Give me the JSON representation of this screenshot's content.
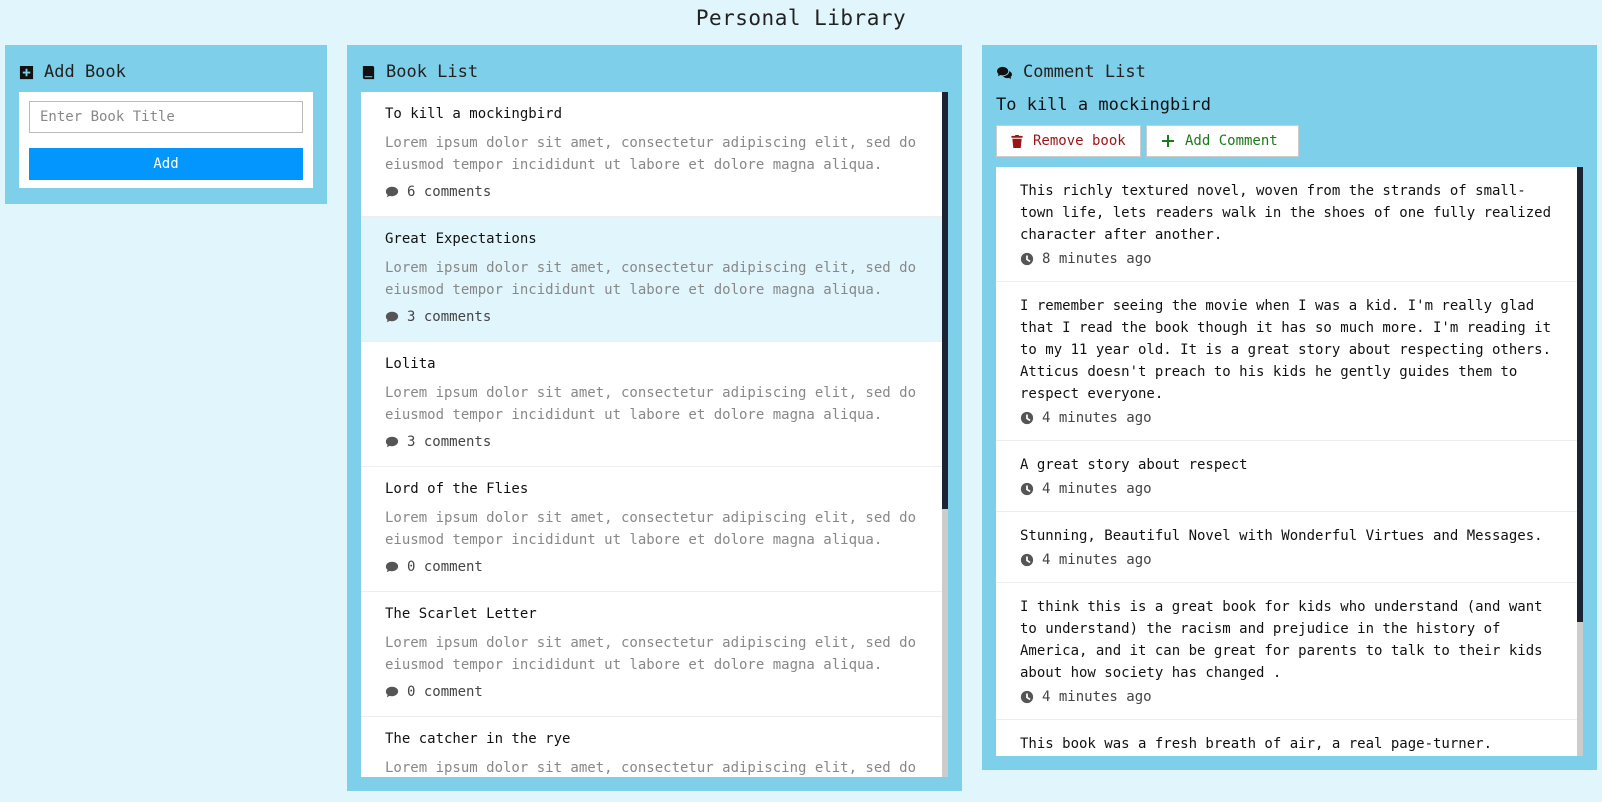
{
  "app": {
    "title": "Personal Library"
  },
  "add_panel": {
    "heading": "Add Book",
    "input_placeholder": "Enter Book Title",
    "add_label": "Add"
  },
  "book_panel": {
    "heading": "Book List",
    "books": [
      {
        "title": "To kill a mockingbird",
        "description": "Lorem ipsum dolor sit amet, consectetur adipiscing elit, sed do eiusmod tempor incididunt ut labore et dolore magna aliqua.",
        "comments": "6 comments",
        "active": false
      },
      {
        "title": "Great Expectations",
        "description": "Lorem ipsum dolor sit amet, consectetur adipiscing elit, sed do eiusmod tempor incididunt ut labore et dolore magna aliqua.",
        "comments": "3 comments",
        "active": true
      },
      {
        "title": "Lolita",
        "description": "Lorem ipsum dolor sit amet, consectetur adipiscing elit, sed do eiusmod tempor incididunt ut labore et dolore magna aliqua.",
        "comments": "3 comments",
        "active": false
      },
      {
        "title": "Lord of the Flies",
        "description": "Lorem ipsum dolor sit amet, consectetur adipiscing elit, sed do eiusmod tempor incididunt ut labore et dolore magna aliqua.",
        "comments": "0 comment",
        "active": false
      },
      {
        "title": "The Scarlet Letter",
        "description": "Lorem ipsum dolor sit amet, consectetur adipiscing elit, sed do eiusmod tempor incididunt ut labore et dolore magna aliqua.",
        "comments": "0 comment",
        "active": false
      },
      {
        "title": "The catcher in the rye",
        "description": "Lorem ipsum dolor sit amet, consectetur adipiscing elit, sed do eiusmod tempor incididunt ut labore et dolore magna aliqua.",
        "comments": "",
        "active": false
      }
    ]
  },
  "comment_panel": {
    "heading": "Comment List",
    "selected_book": "To kill a mockingbird",
    "remove_label": "Remove book",
    "add_comment_label": "Add Comment",
    "comments": [
      {
        "text": "This richly textured novel, woven from the strands of small-town life, lets readers walk in the shoes of one fully realized character after another.",
        "time": "8 minutes ago"
      },
      {
        "text": "I remember seeing the movie when I was a kid. I'm really glad that I read the book though it has so much more. I'm reading it to my 11 year old. It is a great story about respecting others. Atticus doesn't preach to his kids he gently guides them to respect everyone.",
        "time": "4 minutes ago"
      },
      {
        "text": "A great story about respect",
        "time": "4 minutes ago"
      },
      {
        "text": "Stunning, Beautiful Novel with Wonderful Virtues and Messages.",
        "time": "4 minutes ago"
      },
      {
        "text": "I think this is a great book for kids who understand (and want to understand) the racism and prejudice in the history of America, and it can be great for parents to talk to their kids about how society has changed .",
        "time": "4 minutes ago"
      },
      {
        "text": "This book was a fresh breath of air, a real page-turner.",
        "time": ""
      }
    ]
  },
  "colors": {
    "panel": "#7ecfe9",
    "background": "#e1f5fc",
    "primary": "#0496ff",
    "danger": "#9b1515",
    "success": "#1a7a1a"
  }
}
